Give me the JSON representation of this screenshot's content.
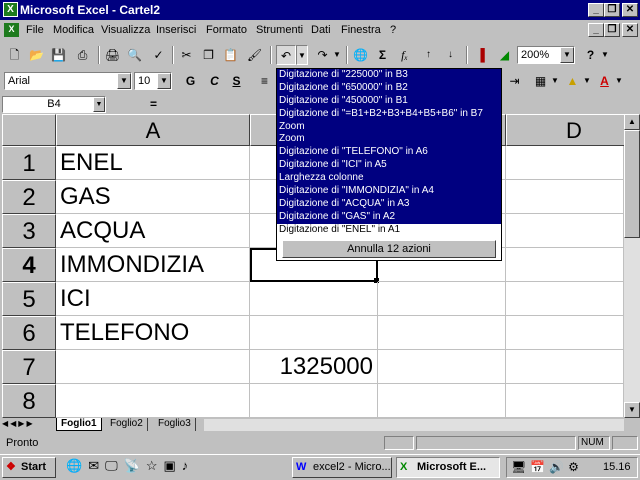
{
  "window": {
    "title": "Microsoft Excel - Cartel2",
    "app_icon": "X",
    "min_label": "_",
    "restore_label": "❒",
    "close_label": "✕"
  },
  "menu": {
    "icon": "X",
    "items": [
      "File",
      "Modifica",
      "Visualizza",
      "Inserisci",
      "Formato",
      "Strumenti",
      "Dati",
      "Finestra",
      "?"
    ]
  },
  "toolbar": {
    "zoom": "200%",
    "help_label": "?",
    "sum_label": "Σ",
    "fx_label": "fₓ",
    "bold_label": "G",
    "italic_label": "C",
    "underline_label": "S"
  },
  "formatting": {
    "font": "Arial",
    "size": "10"
  },
  "formula_bar": {
    "name_box": "B4",
    "equals": "="
  },
  "grid": {
    "columns": [
      "A",
      "B",
      "C",
      "D"
    ],
    "rows": [
      "1",
      "2",
      "3",
      "4",
      "5",
      "6",
      "7",
      "8"
    ],
    "cells": {
      "A1": "ENEL",
      "A2": "GAS",
      "A3": "ACQUA",
      "A4": "IMMONDIZIA",
      "A5": "ICI",
      "A6": "TELEFONO",
      "B7": "1325000"
    },
    "active_cell": "B4"
  },
  "undo_dropdown": {
    "items": [
      "Digitazione di \"225000\" in B3",
      "Digitazione di \"650000\" in B2",
      "Digitazione di \"450000\" in B1",
      "Digitazione di \"=B1+B2+B3+B4+B5+B6\" in B7",
      "Zoom",
      "Zoom",
      "Digitazione di \"TELEFONO\" in A6",
      "Digitazione di \"ICI\" in A5",
      "Larghezza colonne",
      "Digitazione di \"IMMONDIZIA\" in A4",
      "Digitazione di \"ACQUA\" in A3",
      "Digitazione di \"GAS\" in A2",
      "Digitazione di \"ENEL\" in A1"
    ],
    "selected_count": 12,
    "status": "Annulla 12 azioni"
  },
  "sheets": {
    "tabs": [
      "Foglio1",
      "Foglio2",
      "Foglio3"
    ],
    "active": "Foglio1"
  },
  "status": {
    "text": "Pronto",
    "num": "NUM"
  },
  "taskbar": {
    "start": "Start",
    "tasks": [
      "excel2 - Micro...",
      "Microsoft E..."
    ],
    "clock": "15.16"
  }
}
